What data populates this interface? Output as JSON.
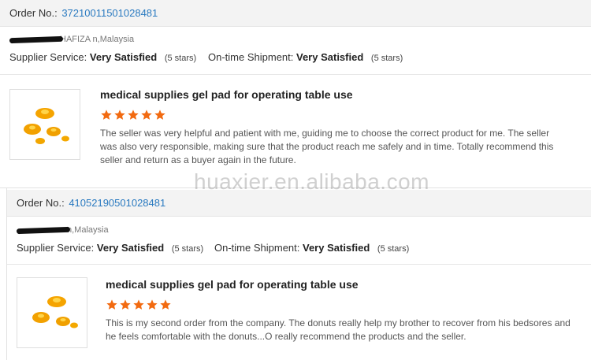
{
  "reviews": [
    {
      "order_label": "Order No.:",
      "order_number": "37210011501028481",
      "buyer_visible": "HAFIZA          n,Malaysia",
      "supplier_label": "Supplier Service:",
      "supplier_value": "Very Satisfied",
      "supplier_stars": "(5 stars)",
      "shipment_label": "On-time Shipment:",
      "shipment_value": "Very Satisfied",
      "shipment_stars": "(5 stars)",
      "product_title": "medical supplies gel pad for operating table use",
      "rating": 5,
      "review_text": "The seller was very helpful and patient with me, guiding me to choose the correct product for me. The seller was also very responsible, making sure that the product reach me safely and in time. Totally recommend this seller and return as a buyer again in the future."
    },
    {
      "order_label": "Order No.:",
      "order_number": "41052190501028481",
      "buyer_visible": "n,Malaysia",
      "supplier_label": "Supplier Service:",
      "supplier_value": "Very Satisfied",
      "supplier_stars": "(5 stars)",
      "shipment_label": "On-time Shipment:",
      "shipment_value": "Very Satisfied",
      "shipment_stars": "(5 stars)",
      "product_title": "medical supplies gel pad for operating table use",
      "rating": 5,
      "review_text": "This is my second order from the company. The donuts really help my brother to recover from his bedsores and he feels comfortable with the donuts...O really recommend the products and the seller."
    }
  ],
  "watermark": "huaxier.en.alibaba.com",
  "colors": {
    "star": "#f26a10",
    "order_link": "#2a7ac0"
  },
  "icons": {
    "rating_star": "star-icon"
  }
}
